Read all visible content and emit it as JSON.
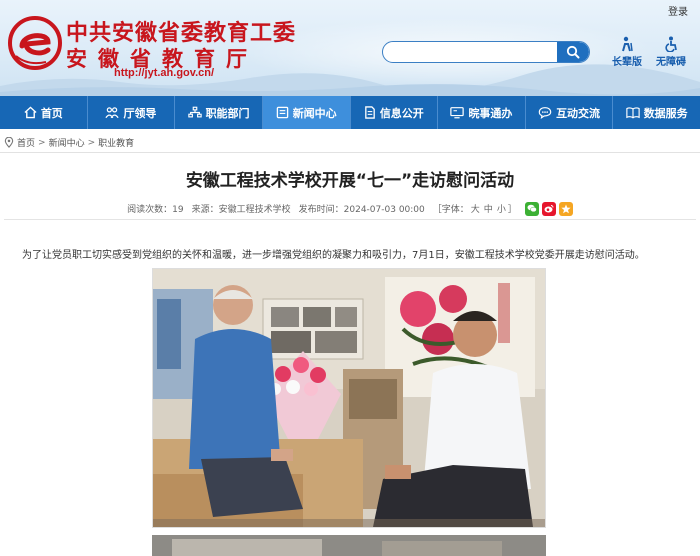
{
  "header": {
    "login": "登录",
    "title_line1": "中共安徽省委教育工委",
    "title_line2": "安徽省教育厅",
    "url": "http://jyt.ah.gov.cn/",
    "search_placeholder": "",
    "tools": [
      {
        "label": "长辈版",
        "icon": "elder-icon"
      },
      {
        "label": "无障碍",
        "icon": "accessibility-icon"
      }
    ],
    "colors": {
      "brand_red": "#c8161d",
      "nav_blue": "#1767b5",
      "nav_active": "#3e8fdc"
    }
  },
  "nav": {
    "items": [
      {
        "label": "首页",
        "icon": "home-icon"
      },
      {
        "label": "厅领导",
        "icon": "leaders-icon"
      },
      {
        "label": "职能部门",
        "icon": "org-chart-icon"
      },
      {
        "label": "新闻中心",
        "icon": "news-icon",
        "active": true
      },
      {
        "label": "信息公开",
        "icon": "document-icon"
      },
      {
        "label": "晥事通办",
        "icon": "service-icon"
      },
      {
        "label": "互动交流",
        "icon": "chat-icon"
      },
      {
        "label": "数据服务",
        "icon": "data-book-icon"
      }
    ]
  },
  "breadcrumb": {
    "items": [
      "首页",
      "新闻中心",
      "职业教育"
    ],
    "separator": ">"
  },
  "article": {
    "title": "安徽工程技术学校开展“七一”走访慰问活动",
    "meta": {
      "views_label": "阅读次数：",
      "views": "19",
      "source_label": "来源：",
      "source": "安徽工程技术学校",
      "time_label": "发布时间：",
      "time": "2024-07-03 00:00",
      "font_label_open": "［字体：",
      "font_large": "大",
      "font_medium": "中",
      "font_small": "小",
      "font_label_close": "］"
    },
    "share_icons": [
      "wechat-icon",
      "weibo-icon",
      "qzone-icon"
    ],
    "paragraph": "为了让党员职工切实感受到党组织的关怀和温暖，进一步增强党组织的凝聚力和吸引力，7月1日，安徽工程技术学校党委开展走访慰问活动。"
  }
}
